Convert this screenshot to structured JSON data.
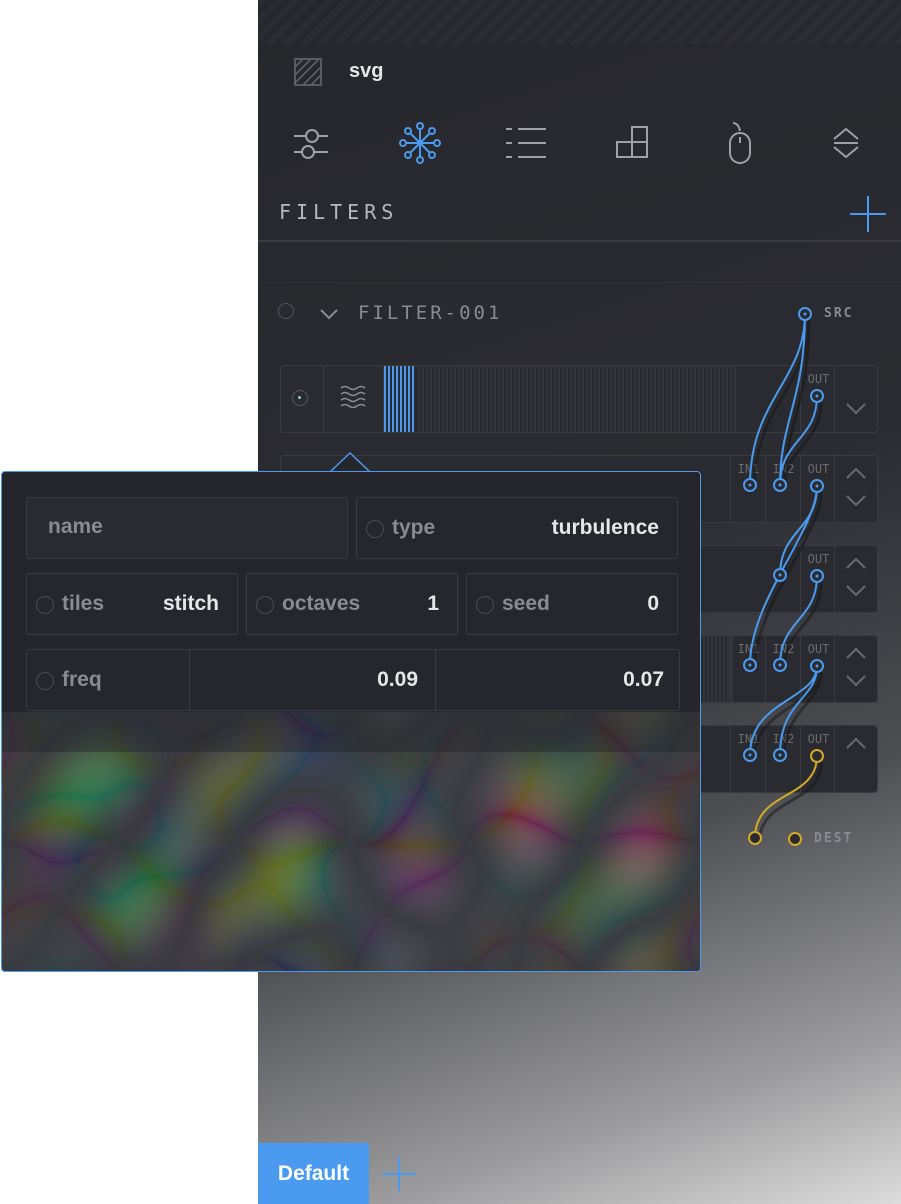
{
  "document": {
    "title": "svg"
  },
  "toolbar": {
    "icons": [
      "sliders-icon",
      "filters-icon",
      "list-icon",
      "blocks-icon",
      "mouse-icon",
      "expand-collapse-icon"
    ]
  },
  "filters_section": {
    "title": "FILTERS"
  },
  "filter": {
    "name": "FILTER-001",
    "src_label": "SRC",
    "dest_label": "DEST"
  },
  "primitive_rows": [
    {
      "ports": [
        "OUT"
      ]
    },
    {
      "ports": [
        "IN1",
        "IN2",
        "OUT"
      ]
    },
    {
      "ports": [
        "OUT"
      ]
    },
    {
      "ports": [
        "IN1",
        "IN2",
        "OUT"
      ]
    },
    {
      "ports": [
        "IN1",
        "IN2",
        "OUT"
      ]
    }
  ],
  "editor": {
    "name_placeholder": "name",
    "type_label": "type",
    "type_value": "turbulence",
    "tiles_label": "tiles",
    "tiles_value": "stitch",
    "octaves_label": "octaves",
    "octaves_value": "1",
    "seed_label": "seed",
    "seed_value": "0",
    "freq_label": "freq",
    "freq_x": "0.09",
    "freq_y": "0.07"
  },
  "bottom_tabs": {
    "active": "Default"
  },
  "colors": {
    "accent": "#4a9bf0",
    "dest_wire": "#d4a928",
    "panel_bg": "#2a2b30"
  }
}
